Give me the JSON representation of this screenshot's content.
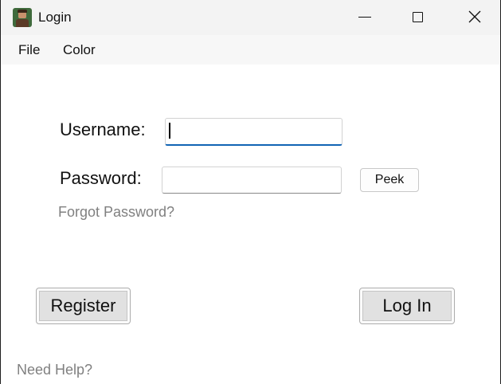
{
  "window": {
    "title": "Login",
    "app_icon": "user-avatar-icon"
  },
  "title_controls": {
    "minimize_icon": "minimize-icon",
    "maximize_icon": "maximize-icon",
    "close_icon": "close-icon"
  },
  "menu": {
    "items": [
      {
        "label": "File"
      },
      {
        "label": "Color"
      }
    ]
  },
  "form": {
    "username_label": "Username:",
    "username_value": "",
    "password_label": "Password:",
    "password_value": "",
    "peek_label": "Peek",
    "forgot_link": "Forgot Password?"
  },
  "actions": {
    "register_label": "Register",
    "login_label": "Log In"
  },
  "footer": {
    "help_link": "Need Help?"
  },
  "colors": {
    "focus_underline": "#1164b4",
    "link_text": "#808080",
    "button_face": "#e1e1e1"
  }
}
